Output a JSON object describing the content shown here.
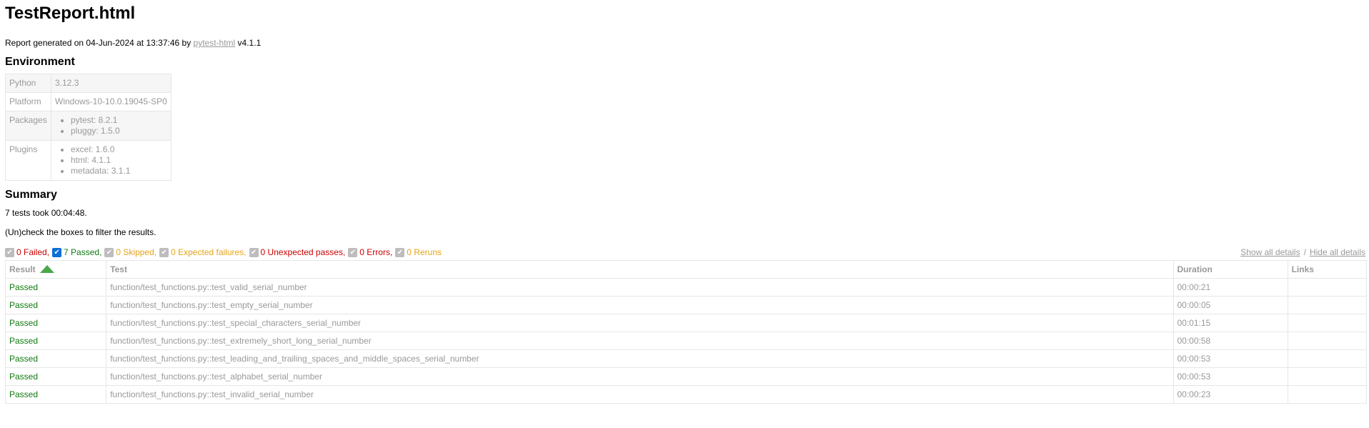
{
  "report": {
    "title": "TestReport.html",
    "generated_prefix": "Report generated on 04-Jun-2024 at 13:37:46 by ",
    "generator_link": "pytest-html",
    "generator_version": " v4.1.1"
  },
  "environment": {
    "heading": "Environment",
    "python": {
      "key": "Python",
      "value": "3.12.3"
    },
    "platform": {
      "key": "Platform",
      "value": "Windows-10-10.0.19045-SP0"
    },
    "packages": {
      "key": "Packages",
      "items": [
        "pytest: 8.2.1",
        "pluggy: 1.5.0"
      ]
    },
    "plugins": {
      "key": "Plugins",
      "items": [
        "excel: 1.6.0",
        "html: 4.1.1",
        "metadata: 3.1.1"
      ]
    }
  },
  "summary": {
    "heading": "Summary",
    "duration_text": "7 tests took 00:04:48.",
    "filter_hint": "(Un)check the boxes to filter the results."
  },
  "filters": [
    {
      "label": "0 Failed,",
      "checked": true
    },
    {
      "label": "7 Passed,",
      "checked": true
    },
    {
      "label": "0 Skipped,",
      "checked": true
    },
    {
      "label": "0 Expected failures,",
      "checked": true
    },
    {
      "label": "0 Unexpected passes,",
      "checked": true
    },
    {
      "label": "0 Errors,",
      "checked": true
    },
    {
      "label": "0 Reruns",
      "checked": true
    }
  ],
  "details": {
    "show_all": "Show all details",
    "separator": "/",
    "hide_all": "Hide all details"
  },
  "results_table": {
    "headers": {
      "result": "Result",
      "test": "Test",
      "duration": "Duration",
      "links": "Links"
    },
    "rows": [
      {
        "result": "Passed",
        "test": "function/test_functions.py::test_valid_serial_number",
        "duration": "00:00:21",
        "links": ""
      },
      {
        "result": "Passed",
        "test": "function/test_functions.py::test_empty_serial_number",
        "duration": "00:00:05",
        "links": ""
      },
      {
        "result": "Passed",
        "test": "function/test_functions.py::test_special_characters_serial_number",
        "duration": "00:01:15",
        "links": ""
      },
      {
        "result": "Passed",
        "test": "function/test_functions.py::test_extremely_short_long_serial_number",
        "duration": "00:00:58",
        "links": ""
      },
      {
        "result": "Passed",
        "test": "function/test_functions.py::test_leading_and_trailing_spaces_and_middle_spaces_serial_number",
        "duration": "00:00:53",
        "links": ""
      },
      {
        "result": "Passed",
        "test": "function/test_functions.py::test_alphabet_serial_number",
        "duration": "00:00:53",
        "links": ""
      },
      {
        "result": "Passed",
        "test": "function/test_functions.py::test_invalid_serial_number",
        "duration": "00:00:23",
        "links": ""
      }
    ]
  },
  "colors": {
    "passed": "#107a10",
    "failed": "#cc0000",
    "skipped": "#e6a41c",
    "muted": "#999999",
    "checkbox_active": "#0b6fd8",
    "sort_arrow": "#4aa84a"
  }
}
